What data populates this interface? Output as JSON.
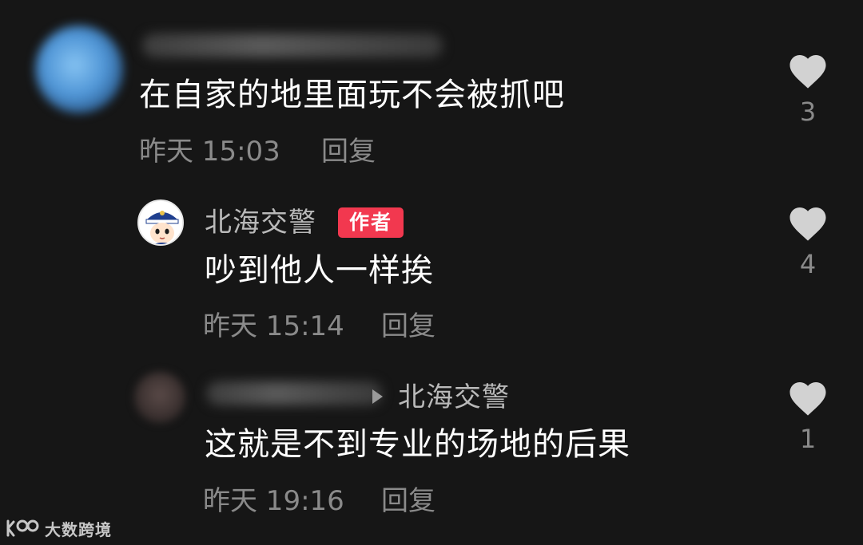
{
  "comments": [
    {
      "text": "在自家的地里面玩不会被抓吧",
      "time": "昨天 15:03",
      "reply_label": "回复",
      "likes": "3"
    },
    {
      "author": "北海交警",
      "badge": "作者",
      "text": "吵到他人一样挨",
      "time": "昨天 15:14",
      "reply_label": "回复",
      "likes": "4"
    },
    {
      "reply_to": "北海交警",
      "text": "这就是不到专业的场地的后果",
      "time": "昨天 19:16",
      "reply_label": "回复",
      "likes": "1"
    }
  ],
  "watermark": {
    "text": "大数跨境"
  },
  "icons": {
    "like": "heart-icon",
    "reply_to": "triangle-right-icon",
    "watermark_logo": "logo-icon"
  },
  "colors": {
    "background": "#161616",
    "badge": "#f2384f",
    "secondary_text": "#8a8a8a",
    "heart": "#d2d2d2"
  }
}
